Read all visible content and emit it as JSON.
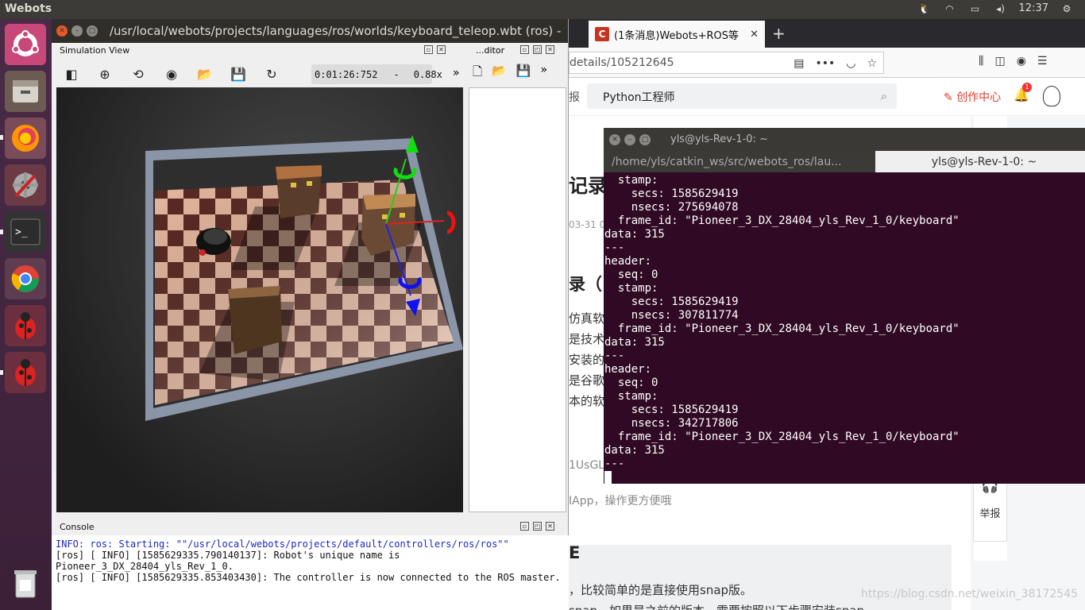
{
  "top_panel": {
    "app_title": "Webots",
    "clock": "12:37"
  },
  "launcher": {
    "items": [
      "ubuntu-dash-icon",
      "files-icon",
      "firefox-icon",
      "settings-icon",
      "terminal-icon",
      "chrome-icon",
      "webots-icon",
      "webots-icon",
      "trash-icon"
    ]
  },
  "webots": {
    "title": "/usr/local/webots/projects/languages/ros/worlds/keyboard_teleop.wbt (ros) -",
    "simulation_view_label": "Simulation View",
    "editor_label": "...ditor",
    "sim_time": "0:01:26:752",
    "sim_separator": "-",
    "speed": "0.88x",
    "overflow": "»",
    "console_label": "Console",
    "console_lines": [
      {
        "text": "INFO: ros: Starting: \"\"/usr/local/webots/projects/default/controllers/ros/ros\"\"",
        "kind": "info"
      },
      {
        "text": "[ros] [ INFO] [1585629335.790140137]: Robot's unique name is",
        "kind": "normal"
      },
      {
        "text": "Pioneer_3_DX_28404_yls_Rev_1_0.",
        "kind": "normal"
      },
      {
        "text": "[ros] [ INFO] [1585629335.853403430]: The controller is now connected to the ROS master.",
        "kind": "normal"
      }
    ]
  },
  "browser": {
    "tab_title": "(1条消息)Webots+ROS等",
    "tab_favicon": "C",
    "url": "details/105212645",
    "search_text": "Python工程师",
    "create_center": "创作中心",
    "notification_count": "1",
    "article_title_fragment": "记录",
    "date_fragment": "03-31 0",
    "heading2_fragment": "录（",
    "body_fragments": [
      "仿真软",
      "是技术",
      "安装的",
      "是谷歌",
      "本的软"
    ],
    "gray_fragment1": "1UsGL",
    "gray_fragment2": "IApp，操作更方便哦",
    "heading3_fragment": "E",
    "para1": "，比较简单的是直接使用snap版。",
    "para2": "snap，如果是之前的版本，需要按照以下步骤安装snap",
    "report_label": "举报",
    "left_fragment": "报",
    "watermark": "https://blog.csdn.net/weixin_38172545"
  },
  "terminal": {
    "title": "yls@yls-Rev-1-0: ~",
    "tab1": "/home/yls/catkin_ws/src/webots_ros/lau...",
    "tab2": "yls@yls-Rev-1-0: ~",
    "output": "  stamp:\n    secs: 1585629419\n    nsecs: 275694078\n  frame_id: \"Pioneer_3_DX_28404_yls_Rev_1_0/keyboard\"\ndata: 315\n---\nheader:\n  seq: 0\n  stamp:\n    secs: 1585629419\n    nsecs: 307811774\n  frame_id: \"Pioneer_3_DX_28404_yls_Rev_1_0/keyboard\"\ndata: 315\n---\nheader:\n  seq: 0\n  stamp:\n    secs: 1585629419\n    nsecs: 342717806\n  frame_id: \"Pioneer_3_DX_28404_yls_Rev_1_0/keyboard\"\ndata: 315\n---\n"
  }
}
